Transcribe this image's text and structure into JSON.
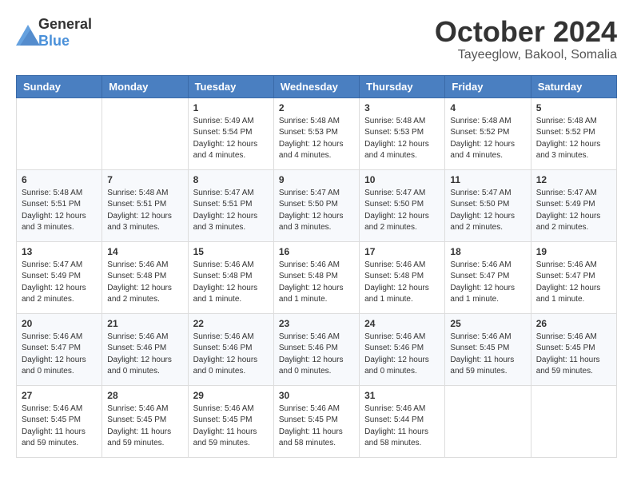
{
  "header": {
    "logo_general": "General",
    "logo_blue": "Blue",
    "month": "October 2024",
    "location": "Tayeeglow, Bakool, Somalia"
  },
  "weekdays": [
    "Sunday",
    "Monday",
    "Tuesday",
    "Wednesday",
    "Thursday",
    "Friday",
    "Saturday"
  ],
  "weeks": [
    [
      {
        "day": "",
        "sunrise": "",
        "sunset": "",
        "daylight": ""
      },
      {
        "day": "",
        "sunrise": "",
        "sunset": "",
        "daylight": ""
      },
      {
        "day": "1",
        "sunrise": "Sunrise: 5:49 AM",
        "sunset": "Sunset: 5:54 PM",
        "daylight": "Daylight: 12 hours and 4 minutes."
      },
      {
        "day": "2",
        "sunrise": "Sunrise: 5:48 AM",
        "sunset": "Sunset: 5:53 PM",
        "daylight": "Daylight: 12 hours and 4 minutes."
      },
      {
        "day": "3",
        "sunrise": "Sunrise: 5:48 AM",
        "sunset": "Sunset: 5:53 PM",
        "daylight": "Daylight: 12 hours and 4 minutes."
      },
      {
        "day": "4",
        "sunrise": "Sunrise: 5:48 AM",
        "sunset": "Sunset: 5:52 PM",
        "daylight": "Daylight: 12 hours and 4 minutes."
      },
      {
        "day": "5",
        "sunrise": "Sunrise: 5:48 AM",
        "sunset": "Sunset: 5:52 PM",
        "daylight": "Daylight: 12 hours and 3 minutes."
      }
    ],
    [
      {
        "day": "6",
        "sunrise": "Sunrise: 5:48 AM",
        "sunset": "Sunset: 5:51 PM",
        "daylight": "Daylight: 12 hours and 3 minutes."
      },
      {
        "day": "7",
        "sunrise": "Sunrise: 5:48 AM",
        "sunset": "Sunset: 5:51 PM",
        "daylight": "Daylight: 12 hours and 3 minutes."
      },
      {
        "day": "8",
        "sunrise": "Sunrise: 5:47 AM",
        "sunset": "Sunset: 5:51 PM",
        "daylight": "Daylight: 12 hours and 3 minutes."
      },
      {
        "day": "9",
        "sunrise": "Sunrise: 5:47 AM",
        "sunset": "Sunset: 5:50 PM",
        "daylight": "Daylight: 12 hours and 3 minutes."
      },
      {
        "day": "10",
        "sunrise": "Sunrise: 5:47 AM",
        "sunset": "Sunset: 5:50 PM",
        "daylight": "Daylight: 12 hours and 2 minutes."
      },
      {
        "day": "11",
        "sunrise": "Sunrise: 5:47 AM",
        "sunset": "Sunset: 5:50 PM",
        "daylight": "Daylight: 12 hours and 2 minutes."
      },
      {
        "day": "12",
        "sunrise": "Sunrise: 5:47 AM",
        "sunset": "Sunset: 5:49 PM",
        "daylight": "Daylight: 12 hours and 2 minutes."
      }
    ],
    [
      {
        "day": "13",
        "sunrise": "Sunrise: 5:47 AM",
        "sunset": "Sunset: 5:49 PM",
        "daylight": "Daylight: 12 hours and 2 minutes."
      },
      {
        "day": "14",
        "sunrise": "Sunrise: 5:46 AM",
        "sunset": "Sunset: 5:48 PM",
        "daylight": "Daylight: 12 hours and 2 minutes."
      },
      {
        "day": "15",
        "sunrise": "Sunrise: 5:46 AM",
        "sunset": "Sunset: 5:48 PM",
        "daylight": "Daylight: 12 hours and 1 minute."
      },
      {
        "day": "16",
        "sunrise": "Sunrise: 5:46 AM",
        "sunset": "Sunset: 5:48 PM",
        "daylight": "Daylight: 12 hours and 1 minute."
      },
      {
        "day": "17",
        "sunrise": "Sunrise: 5:46 AM",
        "sunset": "Sunset: 5:48 PM",
        "daylight": "Daylight: 12 hours and 1 minute."
      },
      {
        "day": "18",
        "sunrise": "Sunrise: 5:46 AM",
        "sunset": "Sunset: 5:47 PM",
        "daylight": "Daylight: 12 hours and 1 minute."
      },
      {
        "day": "19",
        "sunrise": "Sunrise: 5:46 AM",
        "sunset": "Sunset: 5:47 PM",
        "daylight": "Daylight: 12 hours and 1 minute."
      }
    ],
    [
      {
        "day": "20",
        "sunrise": "Sunrise: 5:46 AM",
        "sunset": "Sunset: 5:47 PM",
        "daylight": "Daylight: 12 hours and 0 minutes."
      },
      {
        "day": "21",
        "sunrise": "Sunrise: 5:46 AM",
        "sunset": "Sunset: 5:46 PM",
        "daylight": "Daylight: 12 hours and 0 minutes."
      },
      {
        "day": "22",
        "sunrise": "Sunrise: 5:46 AM",
        "sunset": "Sunset: 5:46 PM",
        "daylight": "Daylight: 12 hours and 0 minutes."
      },
      {
        "day": "23",
        "sunrise": "Sunrise: 5:46 AM",
        "sunset": "Sunset: 5:46 PM",
        "daylight": "Daylight: 12 hours and 0 minutes."
      },
      {
        "day": "24",
        "sunrise": "Sunrise: 5:46 AM",
        "sunset": "Sunset: 5:46 PM",
        "daylight": "Daylight: 12 hours and 0 minutes."
      },
      {
        "day": "25",
        "sunrise": "Sunrise: 5:46 AM",
        "sunset": "Sunset: 5:45 PM",
        "daylight": "Daylight: 11 hours and 59 minutes."
      },
      {
        "day": "26",
        "sunrise": "Sunrise: 5:46 AM",
        "sunset": "Sunset: 5:45 PM",
        "daylight": "Daylight: 11 hours and 59 minutes."
      }
    ],
    [
      {
        "day": "27",
        "sunrise": "Sunrise: 5:46 AM",
        "sunset": "Sunset: 5:45 PM",
        "daylight": "Daylight: 11 hours and 59 minutes."
      },
      {
        "day": "28",
        "sunrise": "Sunrise: 5:46 AM",
        "sunset": "Sunset: 5:45 PM",
        "daylight": "Daylight: 11 hours and 59 minutes."
      },
      {
        "day": "29",
        "sunrise": "Sunrise: 5:46 AM",
        "sunset": "Sunset: 5:45 PM",
        "daylight": "Daylight: 11 hours and 59 minutes."
      },
      {
        "day": "30",
        "sunrise": "Sunrise: 5:46 AM",
        "sunset": "Sunset: 5:45 PM",
        "daylight": "Daylight: 11 hours and 58 minutes."
      },
      {
        "day": "31",
        "sunrise": "Sunrise: 5:46 AM",
        "sunset": "Sunset: 5:44 PM",
        "daylight": "Daylight: 11 hours and 58 minutes."
      },
      {
        "day": "",
        "sunrise": "",
        "sunset": "",
        "daylight": ""
      },
      {
        "day": "",
        "sunrise": "",
        "sunset": "",
        "daylight": ""
      }
    ]
  ]
}
